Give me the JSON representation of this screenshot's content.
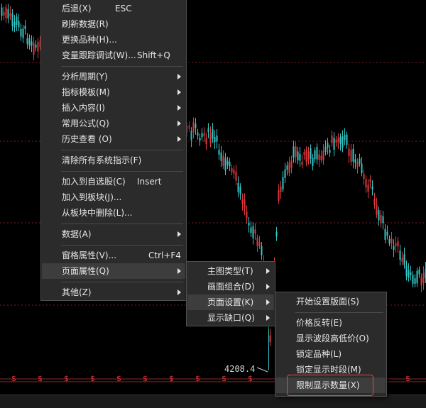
{
  "colors": {
    "bg": "#000000",
    "up": "#e0393e",
    "down": "#35c8c8",
    "grid": "#7a1f1f",
    "marker": "#e0393e",
    "menu_bg": "#2b2b2b",
    "highlight": "#3d3d3d",
    "callout_border": "#e34a4a"
  },
  "chart": {
    "marker_glyph": "$",
    "low_price_label": "4208.4"
  },
  "context_menu": {
    "items": [
      {
        "label": "后退(X)",
        "shortcut": "ESC"
      },
      {
        "label": "刷新数据(R)"
      },
      {
        "label": "更换品种(H)..."
      },
      {
        "label": "变量跟踪调试(W)...",
        "shortcut": "Shift+Q"
      },
      {
        "label": "分析周期(Y)",
        "submenu": true
      },
      {
        "label": "指标模板(M)",
        "submenu": true
      },
      {
        "label": "插入内容(I)",
        "submenu": true
      },
      {
        "label": "常用公式(Q)",
        "submenu": true
      },
      {
        "label": "历史查看 (O)",
        "submenu": true
      },
      {
        "label": "清除所有系统指示(F)"
      },
      {
        "label": "加入到自选股(C)",
        "shortcut": "Insert"
      },
      {
        "label": "加入到板块(J)..."
      },
      {
        "label": "从板块中删除(L)..."
      },
      {
        "label": "数据(A)",
        "submenu": true
      },
      {
        "label": "窗格属性(V)...",
        "shortcut": "Ctrl+F4"
      },
      {
        "label": "页面属性(Q)",
        "submenu": true
      },
      {
        "label": "其他(Z)",
        "submenu": true
      }
    ]
  },
  "page_props_menu": {
    "items": [
      {
        "label": "主图类型(T)",
        "submenu": true
      },
      {
        "label": "画面组合(D)",
        "submenu": true
      },
      {
        "label": "页面设置(K)",
        "submenu": true
      },
      {
        "label": "显示缺口(Q)",
        "submenu": true
      }
    ]
  },
  "page_setup_menu": {
    "items": [
      {
        "label": "开始设置版面(S)"
      },
      {
        "label": "价格反转(E)"
      },
      {
        "label": "显示波段高低价(O)"
      },
      {
        "label": "锁定品种(L)"
      },
      {
        "label": "锁定显示时段(M)"
      },
      {
        "label": "限制显示数量(X)"
      }
    ]
  }
}
